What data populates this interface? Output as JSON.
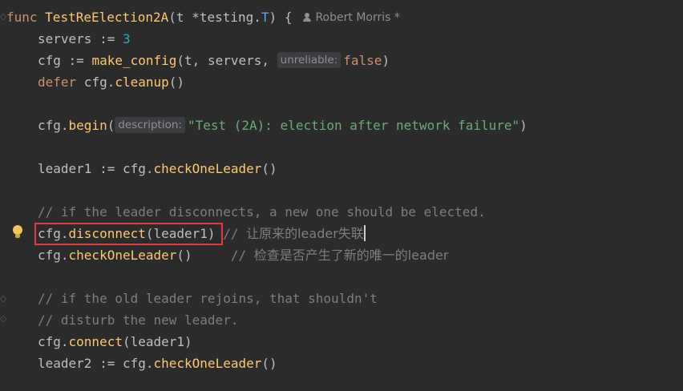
{
  "editor": {
    "author": "Robert Morris *",
    "line1": {
      "kw_func": "func",
      "name": "TestReElection2A",
      "open": "(t ",
      "star": "*",
      "pkg": "testing.",
      "type": "T",
      "close": ") {"
    },
    "line2": {
      "var": "servers := ",
      "num": "3"
    },
    "line3": {
      "prefix": "cfg := ",
      "fn": "make_config",
      "args": "(t, servers, ",
      "hint": "unreliable:",
      "val": "false",
      "end": ")"
    },
    "line4": {
      "kw": "defer",
      "rest": " cfg.",
      "method": "cleanup",
      "end": "()"
    },
    "line5": {
      "prefix": "cfg.",
      "method": "begin",
      "open": "(",
      "hint": "description:",
      "str": "\"Test (2A): election after network failure\"",
      "end": ")"
    },
    "line6": {
      "prefix": "leader1 := cfg.",
      "method": "checkOneLeader",
      "end": "()"
    },
    "line7": {
      "comment": "// if the leader disconnects, a new one should be elected."
    },
    "line8": {
      "prefix": "cfg.",
      "method": "disconnect",
      "args": "(leader1)",
      "comment_slashes": " // ",
      "comment_cn": "让原来的leader失联"
    },
    "line9": {
      "prefix": "cfg.",
      "method": "checkOneLeader",
      "end": "()",
      "comment_slashes": "     // ",
      "comment_cn": "检查是否产生了新的唯一的leader"
    },
    "line10": {
      "comment": "// if the old leader rejoins, that shouldn't"
    },
    "line11": {
      "comment": "// disturb the new leader."
    },
    "line12": {
      "prefix": "cfg.",
      "method": "connect",
      "args": "(leader1)"
    },
    "line13": {
      "prefix": "leader2 := cfg.",
      "method": "checkOneLeader",
      "end": "()"
    }
  },
  "colors": {
    "background": "#2b2b2b",
    "keyword": "#cf8e6d",
    "function": "#ffc66d",
    "number": "#2aacb8",
    "string": "#6aab73",
    "comment": "#7a7e85",
    "highlight": "#e0393e"
  },
  "icons": {
    "bulb": "lightbulb-icon",
    "author": "user-icon"
  }
}
